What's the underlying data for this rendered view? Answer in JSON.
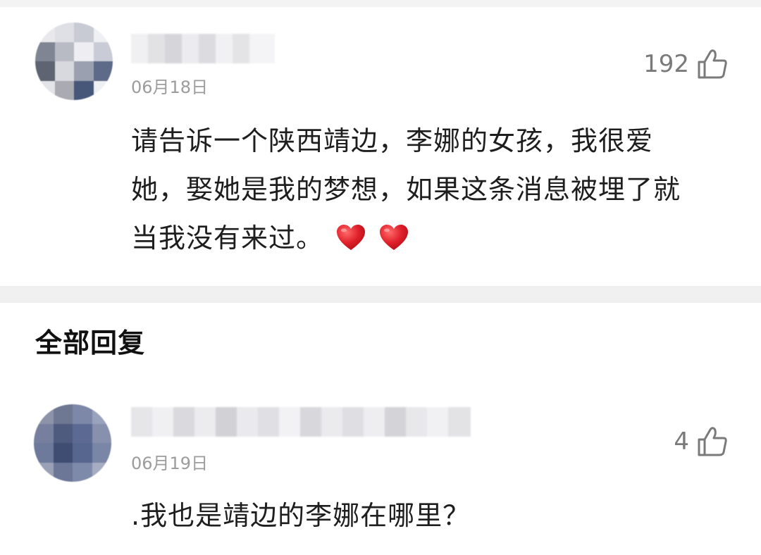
{
  "colors": {
    "page_background": "#ffffff",
    "divider": "#f0f0f0",
    "text_primary": "#1e1e1e",
    "text_secondary": "#9c9c9c",
    "like_count": "#7a7a7a",
    "heart": "#e0202a"
  },
  "main_comment": {
    "date": "06月18日",
    "like_count": "192",
    "like_icon": "thumbs-up-icon",
    "text_lines": [
      "请告诉一个陕西靖边，李娜的女孩，我很爱",
      "她，娶她是我的梦想，如果这条消息被埋了就",
      "当我没有来过。"
    ],
    "emoji": [
      "heart-icon",
      "heart-icon"
    ]
  },
  "replies_section": {
    "title": "全部回复"
  },
  "reply": {
    "date": "06月19日",
    "like_count": "4",
    "like_icon": "thumbs-up-icon",
    "text": ".我也是靖边的李娜在哪里？"
  }
}
